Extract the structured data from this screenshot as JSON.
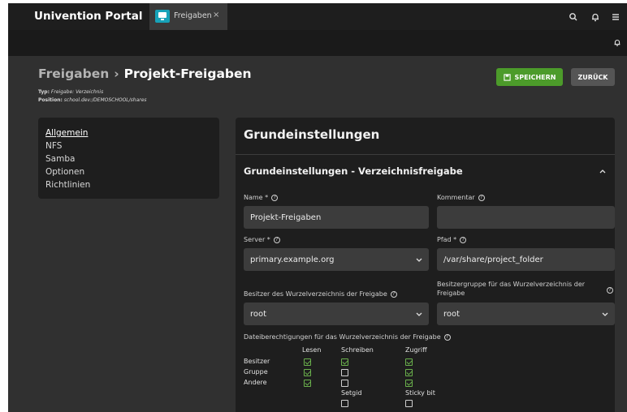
{
  "header": {
    "portal_title": "Univention Portal",
    "tab": {
      "label": "Freigaben",
      "close": "×",
      "icon": "computer-icon"
    },
    "icons": [
      "search-icon",
      "bell-icon",
      "menu-icon"
    ],
    "sub_icon": "bell-icon"
  },
  "page": {
    "breadcrumb_parent": "Freigaben",
    "breadcrumb_sep": "›",
    "breadcrumb_current": "Projekt-Freigaben",
    "info_typ_key": "Typ:",
    "info_typ_val": "Freigabe: Verzeichnis",
    "info_pos_key": "Position:",
    "info_pos_val": "school.dev:/DEMOSCHOOL/shares",
    "save_label": "SPEICHERN",
    "back_label": "ZURÜCK"
  },
  "sidenav": {
    "items": [
      {
        "label": "Allgemein",
        "active": true
      },
      {
        "label": "NFS",
        "active": false
      },
      {
        "label": "Samba",
        "active": false
      },
      {
        "label": "Optionen",
        "active": false
      },
      {
        "label": "Richtlinien",
        "active": false
      }
    ]
  },
  "panel": {
    "title": "Grundeinstellungen",
    "section_title": "Grundeinstellungen - Verzeichnisfreigabe",
    "fields": {
      "name": {
        "label": "Name *",
        "value": "Projekt-Freigaben"
      },
      "kommentar": {
        "label": "Kommentar",
        "value": ""
      },
      "server": {
        "label": "Server *",
        "value": "primary.example.org"
      },
      "pfad": {
        "label": "Pfad *",
        "value": "/var/share/project_folder"
      },
      "besitzer": {
        "label": "Besitzer des Wurzelverzeichnis der Freigabe",
        "value": "root"
      },
      "besitzergruppe": {
        "label_line1": "Besitzergruppe für das Wurzelverzeichnis der",
        "label_line2": "Freigabe",
        "value": "root"
      }
    },
    "permissions": {
      "title": "Dateiberechtigungen für das Wurzelverzeichnis der Freigabe",
      "columns": [
        "Lesen",
        "Schreiben",
        "Zugriff"
      ],
      "rows": [
        {
          "label": "Besitzer",
          "values": [
            true,
            true,
            true
          ]
        },
        {
          "label": "Gruppe",
          "values": [
            true,
            false,
            true
          ]
        },
        {
          "label": "Andere",
          "values": [
            true,
            false,
            true
          ]
        }
      ],
      "extra": [
        {
          "label": "Setgid",
          "checked": false
        },
        {
          "label": "Sticky bit",
          "checked": false
        }
      ]
    }
  },
  "colors": {
    "accent_save": "#4c9b2a",
    "tab_icon": "#17a2b8",
    "check": "#6ab04c"
  }
}
